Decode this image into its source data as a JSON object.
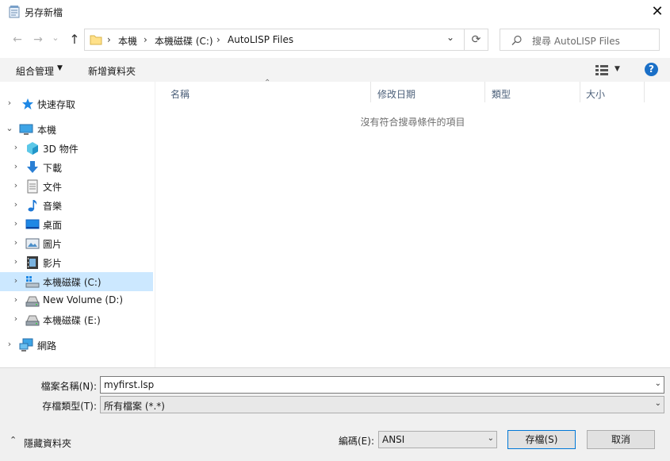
{
  "window": {
    "title": "另存新檔",
    "close_glyph": "✕"
  },
  "nav": {
    "back_glyph": "←",
    "forward_glyph": "→",
    "recent_glyph": "⌄",
    "up_glyph": "↑",
    "breadcrumb": [
      "本機",
      "本機磁碟 (C:)",
      "AutoLISP Files"
    ],
    "separator": "›",
    "refresh_glyph": "⟳",
    "search_placeholder": "搜尋 AutoLISP Files"
  },
  "toolbar": {
    "organize": "組合管理",
    "new_folder": "新增資料夾",
    "view_icon": "view-options-icon",
    "help_glyph": "?"
  },
  "sidebar": {
    "items": [
      {
        "label": "快速存取",
        "icon": "star-icon",
        "expander": "›"
      },
      {
        "label": "本機",
        "icon": "computer-icon",
        "expander": "⌄"
      },
      {
        "label": "3D 物件",
        "icon": "cube-icon",
        "expander": "›"
      },
      {
        "label": "下載",
        "icon": "download-icon",
        "expander": "›"
      },
      {
        "label": "文件",
        "icon": "document-icon",
        "expander": "›"
      },
      {
        "label": "音樂",
        "icon": "music-icon",
        "expander": "›"
      },
      {
        "label": "桌面",
        "icon": "desktop-icon",
        "expander": "›"
      },
      {
        "label": "圖片",
        "icon": "pictures-icon",
        "expander": "›"
      },
      {
        "label": "影片",
        "icon": "video-icon",
        "expander": "›"
      },
      {
        "label": "本機磁碟 (C:)",
        "icon": "windows-drive-icon",
        "expander": "›"
      },
      {
        "label": "New Volume (D:)",
        "icon": "drive-icon",
        "expander": "›"
      },
      {
        "label": "本機磁碟 (E:)",
        "icon": "drive-icon",
        "expander": "›"
      },
      {
        "label": "網路",
        "icon": "network-icon",
        "expander": "›"
      }
    ]
  },
  "file_list": {
    "columns": [
      "名稱",
      "修改日期",
      "類型",
      "大小"
    ],
    "sort_glyph": "⌃",
    "empty_message": "沒有符合搜尋條件的項目"
  },
  "save_form": {
    "filename_label": "檔案名稱(N):",
    "filename_value": "myfirst.lsp",
    "filetype_label": "存檔類型(T):",
    "filetype_value": "所有檔案  (*.*)",
    "encoding_label": "編碼(E):",
    "encoding_value": "ANSI",
    "hide_folders": "隱藏資料夾",
    "save_button": "存檔(S)",
    "cancel_button": "取消",
    "dropdown_glyph": "⌄",
    "collapse_glyph": "⌃"
  },
  "colors": {
    "accent": "#0078d7",
    "selection": "#cce8ff",
    "help": "#1a6fc7"
  }
}
